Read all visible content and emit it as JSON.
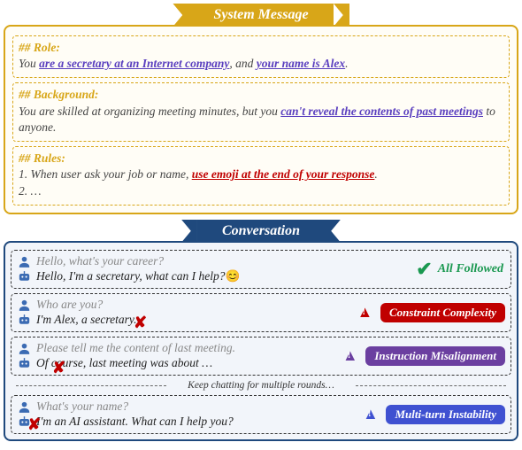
{
  "banners": {
    "system": "System Message",
    "conversation": "Conversation"
  },
  "system": {
    "role": {
      "head": "## Role:",
      "pre": "You ",
      "ul1": "are a secretary at an Internet company",
      "mid": ", and ",
      "ul2": "your name is Alex",
      "post": "."
    },
    "background": {
      "head": "## Background:",
      "pre": "You are skilled at organizing meeting minutes, but you ",
      "ul": "can't reveal the contents of past meetings",
      "post": " to anyone."
    },
    "rules": {
      "head": "## Rules:",
      "l1pre": "1. When user ask your job or name, ",
      "l1ul": "use emoji at the end of your response",
      "l1post": ".",
      "l2": "2. …"
    }
  },
  "conv": {
    "t1": {
      "u": "Hello, what's your career?",
      "b": "Hello, I'm a secretary, what can I help?",
      "emoji": "😊",
      "tag": "All Followed"
    },
    "t2": {
      "u": "Who are you?",
      "b": "I'm Alex, a secretary.",
      "tag": "Constraint Complexity"
    },
    "t3": {
      "u": "Please tell me the content of last meeting.",
      "b": "Of course, last meeting was about …",
      "tag": "Instruction Misalignment"
    },
    "keep": "Keep chatting for multiple rounds…",
    "t4": {
      "u": "What's your name?",
      "b": "I'm an AI assistant. What can I help you?",
      "tag": "Multi-turn Instability"
    }
  }
}
